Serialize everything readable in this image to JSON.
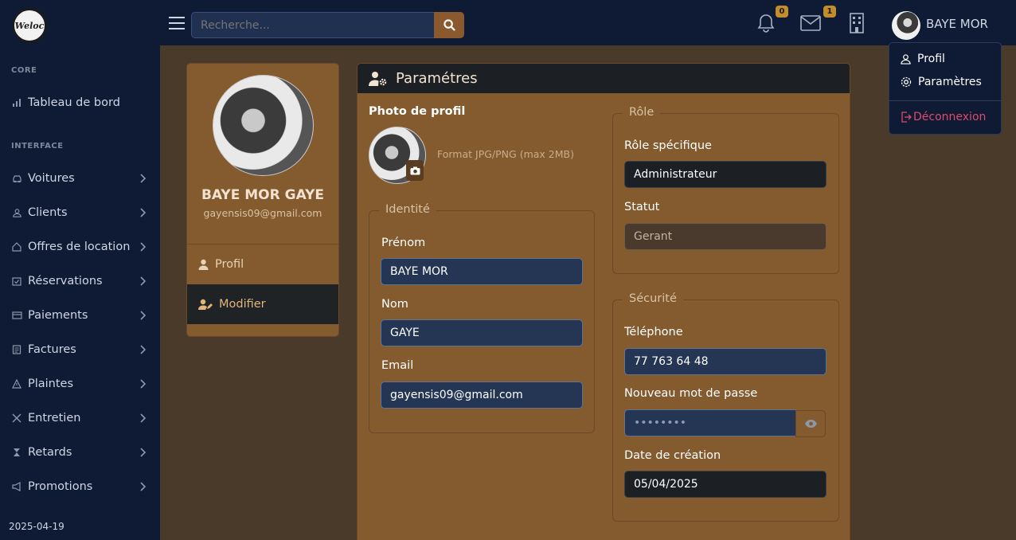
{
  "brand": {
    "logo_text": "Weloc"
  },
  "topbar": {
    "search_placeholder": "Recherche...",
    "notifications_count": "0",
    "messages_count": "1",
    "user_name": "BAYE MOR"
  },
  "user_menu": {
    "items": [
      {
        "label": "Profil",
        "icon": "user-icon"
      },
      {
        "label": "Paramètres",
        "icon": "gear-icon"
      }
    ],
    "logout_label": "Déconnexion"
  },
  "sidebar": {
    "core_heading": "CORE",
    "dashboard_label": "Tableau de bord",
    "interface_heading": "INTERFACE",
    "items": [
      {
        "label": "Voitures",
        "icon": "car-icon"
      },
      {
        "label": "Clients",
        "icon": "user-icon"
      },
      {
        "label": "Offres de location",
        "icon": "home-icon"
      },
      {
        "label": "Réservations",
        "icon": "calendar-check-icon"
      },
      {
        "label": "Paiements",
        "icon": "credit-card-icon"
      },
      {
        "label": "Factures",
        "icon": "invoice-icon"
      },
      {
        "label": "Plaintes",
        "icon": "warning-icon"
      },
      {
        "label": "Entretien",
        "icon": "tools-icon"
      },
      {
        "label": "Retards",
        "icon": "hourglass-icon"
      },
      {
        "label": "Promotions",
        "icon": "megaphone-icon"
      }
    ],
    "footer_date": "2025-04-19"
  },
  "profile_card": {
    "name": "BAYE MOR GAYE",
    "email": "gayensis09@gmail.com",
    "menu": {
      "profil_label": "Profil",
      "modifier_label": "Modifier"
    }
  },
  "settings": {
    "title": "Paramétres",
    "photo_label": "Photo de profil",
    "photo_hint": "Format JPG/PNG (max 2MB)",
    "identity": {
      "legend": "Identité",
      "first_name_label": "Prénom",
      "first_name_value": "BAYE MOR",
      "last_name_label": "Nom",
      "last_name_value": "GAYE",
      "email_label": "Email",
      "email_value": "gayensis09@gmail.com"
    },
    "role": {
      "legend": "Rôle",
      "specific_role_label": "Rôle spécifique",
      "specific_role_value": "Administrateur",
      "status_label": "Statut",
      "status_value": "Gerant"
    },
    "security": {
      "legend": "Sécurité",
      "phone_label": "Téléphone",
      "phone_value": "77 763 64 48",
      "password_label": "Nouveau mot de passe",
      "password_mask": "••••••••",
      "created_label": "Date de création",
      "created_value": "05/04/2025"
    }
  },
  "colors": {
    "navy": "#0f1b35",
    "card_brown": "#845a2f",
    "page_brown": "#4a3a2a",
    "accent_gold": "#c38d2a",
    "logout_red": "#e0496b"
  }
}
